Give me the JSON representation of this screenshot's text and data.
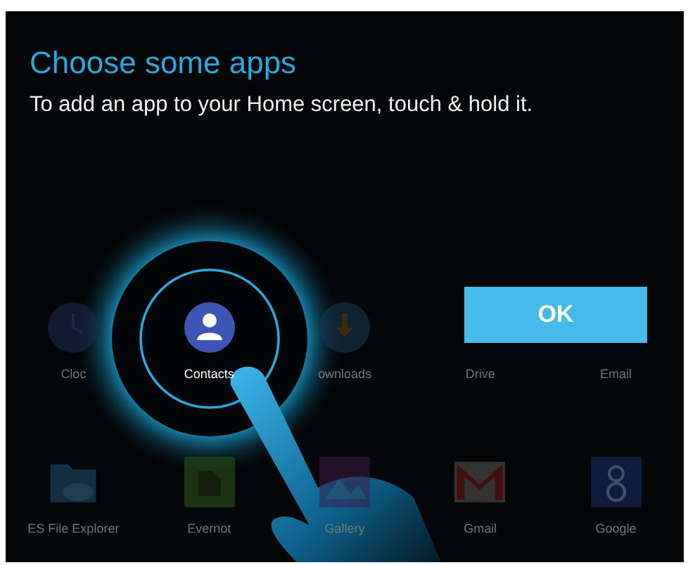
{
  "title": "Choose some apps",
  "subtitle": "To add an app to your Home screen, touch & hold it.",
  "apps": [
    {
      "label": "Cloc",
      "kind": "clock",
      "highlighted": false
    },
    {
      "label": "Contacts",
      "kind": "contacts",
      "highlighted": true
    },
    {
      "label": "ownloads",
      "kind": "download",
      "highlighted": false
    },
    {
      "label": "Drive",
      "kind": "covered",
      "highlighted": false
    },
    {
      "label": "Email",
      "kind": "covered",
      "highlighted": false
    },
    {
      "label": "ES File Explorer",
      "kind": "folder",
      "highlighted": false
    },
    {
      "label": "Evernot",
      "kind": "note",
      "highlighted": false
    },
    {
      "label": "Gallery",
      "kind": "gallery",
      "highlighted": false
    },
    {
      "label": "Gmail",
      "kind": "mail",
      "highlighted": false
    },
    {
      "label": "Google",
      "kind": "search",
      "highlighted": false
    }
  ],
  "ok_button": "OK"
}
